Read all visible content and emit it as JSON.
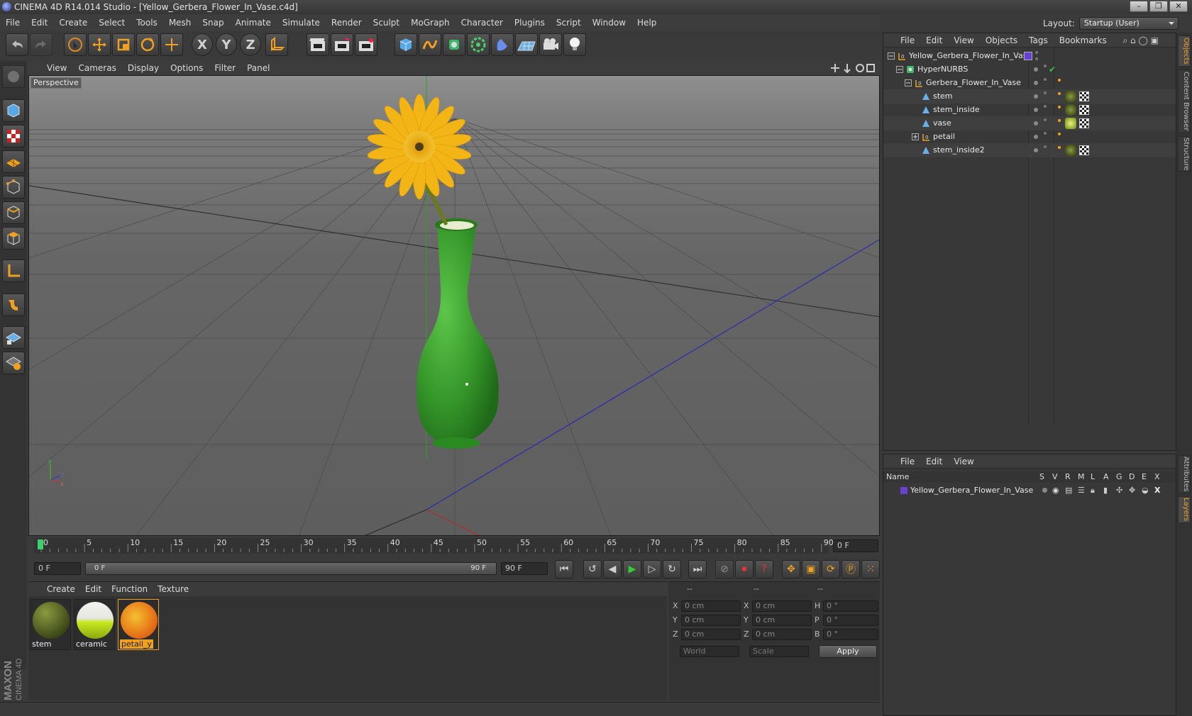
{
  "window": {
    "title": "CINEMA 4D R14.014 Studio - [Yellow_Gerbera_Flower_In_Vase.c4d]"
  },
  "menubar": [
    "File",
    "Edit",
    "Create",
    "Select",
    "Tools",
    "Mesh",
    "Snap",
    "Animate",
    "Simulate",
    "Render",
    "Sculpt",
    "MoGraph",
    "Character",
    "Plugins",
    "Script",
    "Window",
    "Help"
  ],
  "layout": {
    "label": "Layout:",
    "value": "Startup (User)"
  },
  "toolbar": {
    "x_label": "X",
    "y_label": "Y",
    "z_label": "Z"
  },
  "viewport": {
    "menu": [
      "View",
      "Cameras",
      "Display",
      "Options",
      "Filter",
      "Panel"
    ],
    "label": "Perspective"
  },
  "timeline": {
    "ticks": [
      "0",
      "5",
      "10",
      "15",
      "20",
      "25",
      "30",
      "35",
      "40",
      "45",
      "50",
      "55",
      "60",
      "65",
      "70",
      "75",
      "80",
      "85",
      "90"
    ],
    "current_frame": "0 F"
  },
  "transport": {
    "start": "0 F",
    "range_start": "0 F",
    "range_end": "90 F",
    "end": "90 F"
  },
  "materials": {
    "menu": [
      "Create",
      "Edit",
      "Function",
      "Texture"
    ],
    "items": [
      {
        "name": "stem",
        "selected": false
      },
      {
        "name": "ceramic",
        "selected": false
      },
      {
        "name": "petail_y",
        "selected": true
      }
    ]
  },
  "coords": {
    "headers": [
      "--",
      "--",
      "--"
    ],
    "rows": [
      {
        "a": "X",
        "av": "0 cm",
        "b": "X",
        "bv": "0 cm",
        "c": "H",
        "cv": "0 °"
      },
      {
        "a": "Y",
        "av": "0 cm",
        "b": "Y",
        "bv": "0 cm",
        "c": "P",
        "cv": "0 °"
      },
      {
        "a": "Z",
        "av": "0 cm",
        "b": "Z",
        "bv": "0 cm",
        "c": "B",
        "cv": "0 °"
      }
    ],
    "world": "World",
    "scale": "Scale",
    "apply": "Apply"
  },
  "object_manager": {
    "menu": [
      "File",
      "Edit",
      "View",
      "Objects",
      "Tags",
      "Bookmarks"
    ],
    "objects": [
      {
        "name": "Yellow_Gerbera_Flower_In_Vase",
        "icon": "null-icon"
      },
      {
        "name": "HyperNURBS",
        "icon": "hypernurbs-icon"
      },
      {
        "name": "Gerbera_Flower_In_Vase",
        "icon": "null-icon"
      },
      {
        "name": "stem",
        "icon": "polygon-icon"
      },
      {
        "name": "stem_inside",
        "icon": "polygon-icon"
      },
      {
        "name": "vase",
        "icon": "polygon-icon"
      },
      {
        "name": "petail",
        "icon": "null-icon"
      },
      {
        "name": "stem_inside2",
        "icon": "polygon-icon"
      }
    ]
  },
  "layer_manager": {
    "menu": [
      "File",
      "Edit",
      "View"
    ],
    "columns": [
      "Name",
      "S",
      "V",
      "R",
      "M",
      "L",
      "A",
      "G",
      "D",
      "E",
      "X"
    ],
    "layers": [
      {
        "name": "Yellow_Gerbera_Flower_In_Vase",
        "color": "#6a3fd4"
      }
    ]
  },
  "right_tabs": [
    "Objects",
    "Content Browser",
    "Structure",
    "Attributes",
    "Layers"
  ],
  "branding": {
    "maxon": "MAXON",
    "cinema": "CINEMA 4D"
  },
  "colors": {
    "vase": "#3c9a2e",
    "flower": "#f2b515",
    "accent": "#f0a020",
    "layer": "#6a3fd4"
  }
}
